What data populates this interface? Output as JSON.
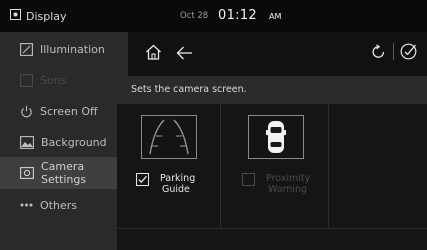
{
  "app": {
    "title": "Display",
    "icon": "display-settings-icon"
  },
  "clock": {
    "date": "Oct 28",
    "time": "01:12",
    "ampm": "AM"
  },
  "sidebar": {
    "items": [
      {
        "label": "Illumination",
        "icon": "illumination-icon",
        "state": "normal"
      },
      {
        "label": "Sons",
        "icon": "sound-icon",
        "state": "disabled"
      },
      {
        "label": "Screen Off",
        "icon": "power-icon",
        "state": "normal"
      },
      {
        "label": "Background",
        "icon": "background-image-icon",
        "state": "normal"
      },
      {
        "label": "Camera Settings",
        "icon": "camera-icon",
        "state": "selected"
      },
      {
        "label": "Others",
        "icon": "more-dots-icon",
        "state": "normal"
      }
    ]
  },
  "toolbar": {
    "home": "home-icon",
    "back": "back-arrow-icon",
    "reset": "reset-icon",
    "confirm": "confirm-check-icon"
  },
  "main": {
    "hint": "Sets the camera screen.",
    "options": [
      {
        "label_line1": "Parking",
        "label_line2": "Guide",
        "checked": true,
        "enabled": true,
        "icon": "parking-guide-lines-icon"
      },
      {
        "label_line1": "Proximity",
        "label_line2": "Warning",
        "checked": false,
        "enabled": false,
        "icon": "car-proximity-icon"
      }
    ]
  }
}
